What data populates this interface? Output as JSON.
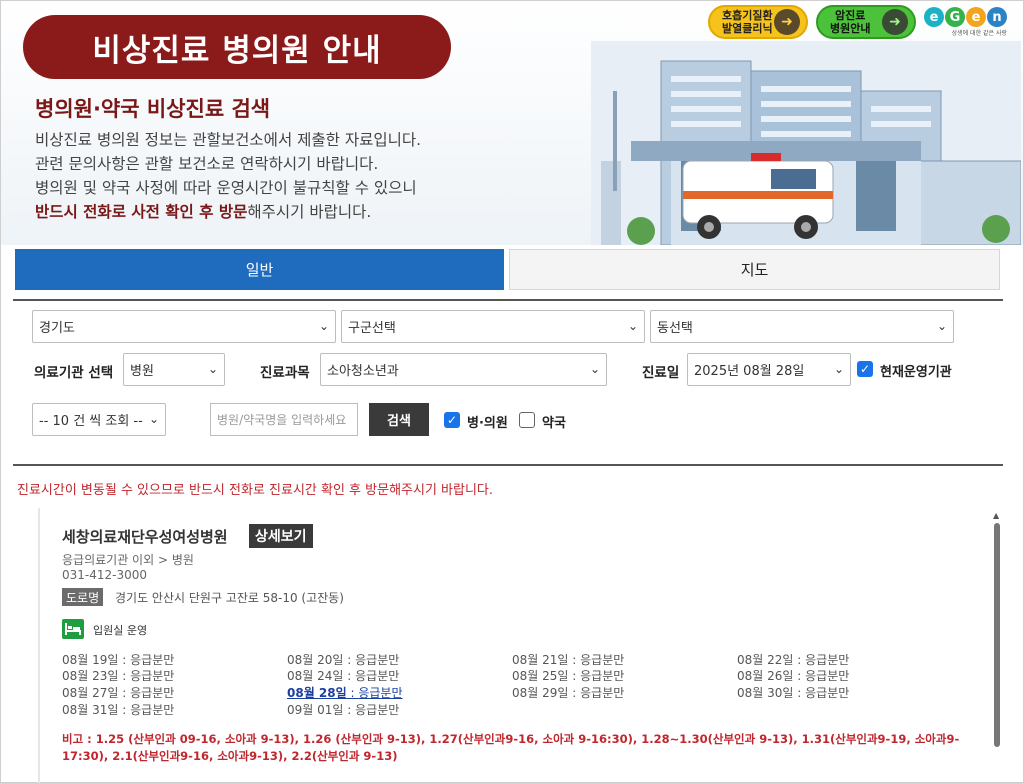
{
  "banner": {
    "title": "비상진료 병의원 안내",
    "subtitle": "병의원·약국 비상진료 검색",
    "desc_line1": "비상진료 병의원 정보는 관할보건소에서 제출한 자료입니다.",
    "desc_line2": "관련 문의사항은 관할 보건소로 연락하시기 바랍니다.",
    "desc_line3": "병의원 및 약국 사정에 따라 운영시간이 불규칙할 수 있으니",
    "desc_line4_strong": "반드시 전화로 사전 확인 후 방문",
    "desc_line4_rest": "해주시기 바랍니다.",
    "badge1_line1": "호흡기질환",
    "badge1_line2": "발열클리닉",
    "badge2_line1": "암진료",
    "badge2_line2": "병원안내",
    "logo_letters": [
      "e",
      "G",
      "e",
      "n"
    ],
    "logo_tagline": "상생에 대한 같은 사랑",
    "colors": {
      "title_bg": "#8b1a1a",
      "accent": "#1f6cbf",
      "alert": "#c0262d"
    }
  },
  "tabs": {
    "general": "일반",
    "map": "지도"
  },
  "filters": {
    "province": "경기도",
    "district": "구군선택",
    "dong": "동선택",
    "facility_label": "의료기관 선택",
    "facility_value": "병원",
    "subject_label": "진료과목",
    "subject_value": "소아청소년과",
    "date_label": "진료일",
    "date_value": "2025년 08월 28일",
    "operating_label": "현재운영기관",
    "page_size": "-- 10 건 씩 조회 --",
    "search_placeholder": "병원/약국명을 입력하세요",
    "search_button": "검색",
    "hospital_label": "병·의원",
    "pharmacy_label": "약국"
  },
  "notice": "진료시간이 변동될 수 있으므로 반드시 전화로 진료시간 확인 후 방문해주시기 바랍니다.",
  "result": {
    "name": "세창의료재단우성여성병원",
    "detail_button": "상세보기",
    "category": "응급의료기관 이외 > 병원",
    "phone": "031-412-3000",
    "road_tag": "도로명",
    "address": "경기도 안산시 단원구 고잔로 58-10 (고잔동)",
    "ward_label": "입원실 운영",
    "days": [
      {
        "date": "08월 19일",
        "status": "응급분만"
      },
      {
        "date": "08월 20일",
        "status": "응급분만"
      },
      {
        "date": "08월 21일",
        "status": "응급분만"
      },
      {
        "date": "08월 22일",
        "status": "응급분만"
      },
      {
        "date": "08월 23일",
        "status": "응급분만"
      },
      {
        "date": "08월 24일",
        "status": "응급분만"
      },
      {
        "date": "08월 25일",
        "status": "응급분만"
      },
      {
        "date": "08월 26일",
        "status": "응급분만"
      },
      {
        "date": "08월 27일",
        "status": "응급분만"
      },
      {
        "date": "08월 28일",
        "status": "응급분만"
      },
      {
        "date": "08월 29일",
        "status": "응급분만"
      },
      {
        "date": "08월 30일",
        "status": "응급분만"
      },
      {
        "date": "08월 31일",
        "status": "응급분만"
      },
      {
        "date": "09월 01일",
        "status": "응급분만"
      }
    ],
    "day_separator": " : ",
    "remark": "비고 : 1.25 (산부인과 09-16, 소아과 9-13), 1.26 (산부인과 9-13), 1.27(산부인과9-16, 소아과 9-16:30), 1.28~1.30(산부인과 9-13), 1.31(산부인과9-19, 소아과9-17:30), 2.1(산부인과9-16, 소아과9-13), 2.2(산부인과 9-13)"
  }
}
